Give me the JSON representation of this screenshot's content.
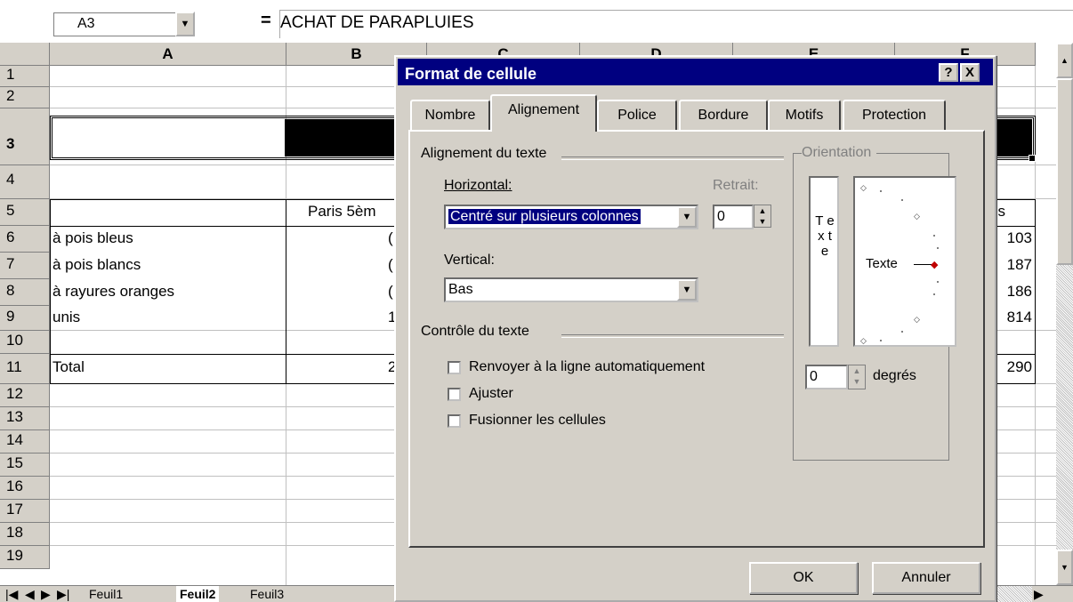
{
  "formula_bar": {
    "cell_ref": "A3",
    "equals": "=",
    "content": "ACHAT DE PARAPLUIES"
  },
  "columns": [
    "A",
    "B",
    "C",
    "D",
    "E",
    "F"
  ],
  "rows": [
    "1",
    "2",
    "3",
    "4",
    "5",
    "6",
    "7",
    "8",
    "9",
    "10",
    "11",
    "12",
    "13",
    "14",
    "15",
    "16",
    "17",
    "18",
    "19"
  ],
  "cells": {
    "a3": "ACHAT DE PARAPLUIES",
    "b5": "Paris 5èm",
    "f5": "ris",
    "a6": "à pois bleus",
    "a7": "à pois blancs",
    "a8": "à rayures oranges",
    "a9": "unis",
    "a11": "Total",
    "b6": "(",
    "b7": "(",
    "b8": "(",
    "b9": "1",
    "b11": "2",
    "f6": "103",
    "f7": "187",
    "f8": "186",
    "f9": "814",
    "f11": "290"
  },
  "sheet_tabs": [
    "Feuil1",
    "Feuil2",
    "Feuil3"
  ],
  "dialog": {
    "title": "Format de cellule",
    "help_btn": "?",
    "close_btn": "X",
    "tabs": [
      "Nombre",
      "Alignement",
      "Police",
      "Bordure",
      "Motifs",
      "Protection"
    ],
    "active_tab": "Alignement",
    "alignment_group": "Alignement du texte",
    "horizontal_label": "Horizontal:",
    "horizontal_value": "Centré sur plusieurs colonnes",
    "retrait_label": "Retrait:",
    "retrait_value": "0",
    "vertical_label": "Vertical:",
    "vertical_value": "Bas",
    "control_group": "Contrôle du texte",
    "wrap_label": "Renvoyer à la ligne automatiquement",
    "shrink_label": "Ajuster",
    "merge_label": "Fusionner les cellules",
    "orientation_group": "Orientation",
    "orientation_vertical_text": "T e x t e",
    "orientation_dial_text": "Texte",
    "degrees_value": "0",
    "degrees_label": "degrés",
    "ok_label": "OK",
    "cancel_label": "Annuler"
  }
}
